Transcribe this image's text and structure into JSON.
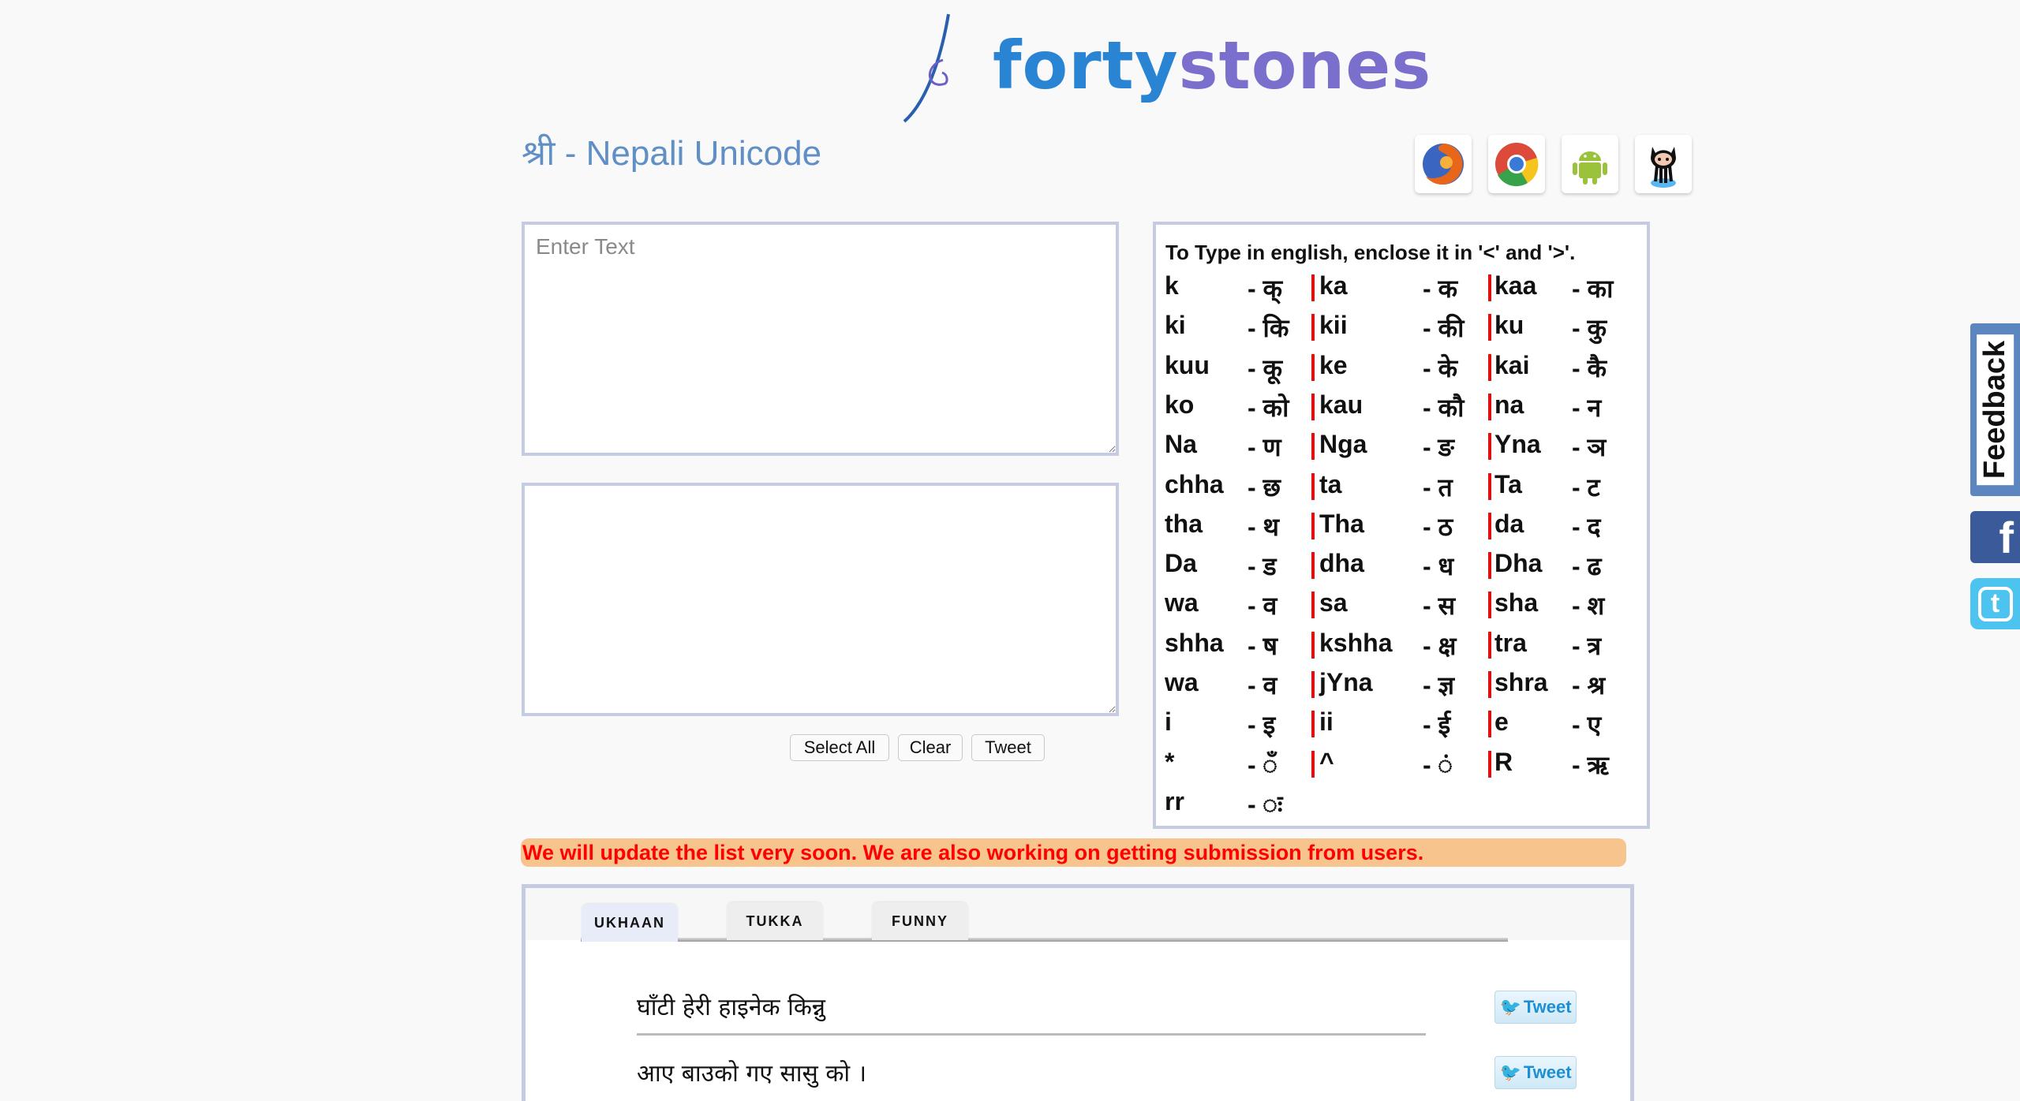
{
  "logo": {
    "part1": "forty",
    "part2": "stones"
  },
  "title": "श्री - Nepali Unicode",
  "extensions": [
    {
      "name": "firefox-icon"
    },
    {
      "name": "chrome-icon"
    },
    {
      "name": "android-icon"
    },
    {
      "name": "github-octocat-icon"
    }
  ],
  "editor": {
    "input_placeholder": "Enter Text",
    "input_value": "",
    "output_value": "",
    "buttons": {
      "select_all": "Select All",
      "clear": "Clear",
      "tweet": "Tweet"
    }
  },
  "mapping": {
    "heading": "To Type in english, enclose it in '<' and '>'.",
    "rows": [
      [
        [
          "k",
          "- क्"
        ],
        [
          "ka",
          "- क"
        ],
        [
          "kaa",
          "- का"
        ]
      ],
      [
        [
          "ki",
          "- कि"
        ],
        [
          "kii",
          "- की"
        ],
        [
          "ku",
          "- कु"
        ]
      ],
      [
        [
          "kuu",
          "- कू"
        ],
        [
          "ke",
          "- के"
        ],
        [
          "kai",
          "- कै"
        ]
      ],
      [
        [
          "ko",
          "- को"
        ],
        [
          "kau",
          "- कौ"
        ],
        [
          "na",
          "- न"
        ]
      ],
      [
        [
          "Na",
          "- ण"
        ],
        [
          "Nga",
          "- ङ"
        ],
        [
          "Yna",
          "- ञ"
        ]
      ],
      [
        [
          "chha",
          "- छ"
        ],
        [
          "ta",
          "- त"
        ],
        [
          "Ta",
          "- ट"
        ]
      ],
      [
        [
          "tha",
          "- थ"
        ],
        [
          "Tha",
          "- ठ"
        ],
        [
          "da",
          "- द"
        ]
      ],
      [
        [
          "Da",
          "- ड"
        ],
        [
          "dha",
          "- ध"
        ],
        [
          "Dha",
          "- ढ"
        ]
      ],
      [
        [
          "wa",
          "- व"
        ],
        [
          "sa",
          "- स"
        ],
        [
          "sha",
          "- श"
        ]
      ],
      [
        [
          "shha",
          "- ष"
        ],
        [
          "kshha",
          "- क्ष"
        ],
        [
          "tra",
          "- त्र"
        ]
      ],
      [
        [
          "wa",
          "- व"
        ],
        [
          "jYna",
          "- ज्ञ"
        ],
        [
          "shra",
          "- श्र"
        ]
      ],
      [
        [
          "i",
          "- इ"
        ],
        [
          "ii",
          "- ई"
        ],
        [
          "e",
          "- ए"
        ]
      ],
      [
        [
          "*",
          "- ँ"
        ],
        [
          "^",
          "- ं"
        ],
        [
          "R",
          "- ऋ"
        ]
      ],
      [
        [
          "rr",
          "- ः"
        ]
      ]
    ]
  },
  "banner": "We will update the list very soon. We are also working on getting submission from users.",
  "quotes": {
    "tabs": [
      "UKHAAN",
      "TUKKA",
      "FUNNY"
    ],
    "active_tab": "UKHAAN",
    "items": [
      {
        "text": "घाँटी हेरी हाइनेक किन्नु",
        "tweet": "Tweet"
      },
      {
        "text": "आए बाउको गए सासु को ।",
        "tweet": "Tweet"
      }
    ]
  },
  "side": {
    "feedback": "Feedback"
  },
  "colors": {
    "title": "#5f8fc4",
    "banner_bg": "#f7c48e",
    "banner_text": "#ff0000",
    "separator": "#e01010",
    "border": "#c5cbe0"
  }
}
